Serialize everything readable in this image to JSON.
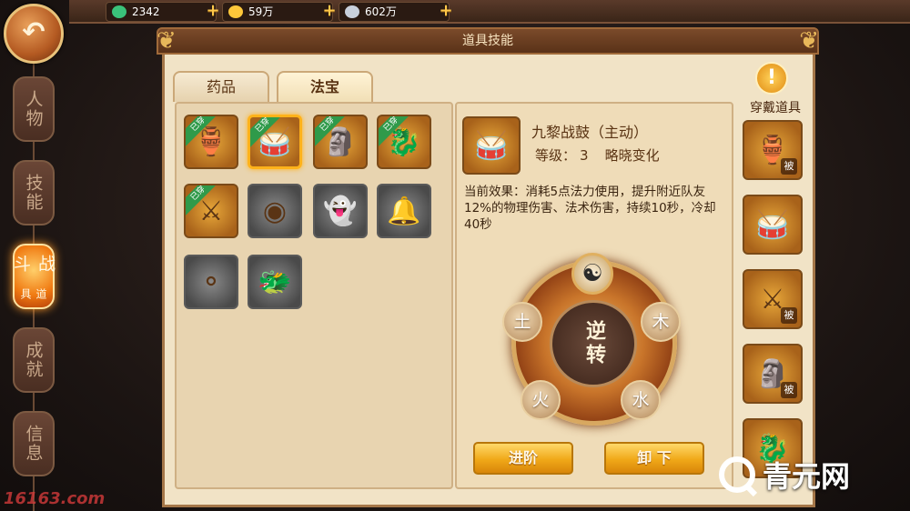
{
  "currencies": [
    {
      "value": "2342",
      "icon": "jade-icon",
      "color": "#3ac27a"
    },
    {
      "value": "59万",
      "icon": "gold-ingot-icon",
      "color": "#ffc83a"
    },
    {
      "value": "602万",
      "icon": "silver-ingot-icon",
      "color": "#c8d0dc"
    }
  ],
  "nav": {
    "items": [
      {
        "label": "人物"
      },
      {
        "label": "技能"
      },
      {
        "label": "战斗",
        "sub": "道具"
      },
      {
        "label": "成就"
      },
      {
        "label": "信息"
      }
    ],
    "active_index": 2
  },
  "panel": {
    "title": "道具技能"
  },
  "tabs": [
    {
      "label": "药品"
    },
    {
      "label": "法宝"
    }
  ],
  "inventory": {
    "equipped_tag": "已穿",
    "slots": [
      {
        "icon": "gourd-icon",
        "equipped": true,
        "colored": true
      },
      {
        "icon": "war-drum-icon",
        "equipped": true,
        "colored": true,
        "selected": true
      },
      {
        "icon": "guardian-statue-icon",
        "equipped": true,
        "colored": true
      },
      {
        "icon": "jade-guardian-icon",
        "equipped": true,
        "colored": true
      },
      {
        "icon": "crossed-swords-icon",
        "equipped": true,
        "colored": true
      },
      {
        "icon": "shield-orb-icon",
        "colored": false
      },
      {
        "icon": "ghost-icon",
        "colored": false
      },
      {
        "icon": "bell-icon",
        "colored": false
      },
      {
        "icon": "beads-icon",
        "colored": false
      },
      {
        "icon": "dragon-icon",
        "colored": false
      }
    ]
  },
  "detail": {
    "name": "九黎战鼓（主动）",
    "level_label": "等级：",
    "level_value": "3",
    "level_extra": "略晓变化",
    "effect": "当前效果：消耗5点法力使用，提升附近队友12%的物理伤害、法术伤害，持续10秒，冷却40秒",
    "wheel": {
      "center": "逆转",
      "elements": [
        "土",
        "木",
        "火",
        "水"
      ]
    },
    "buttons": {
      "advance": "进阶",
      "unequip": "卸 下"
    }
  },
  "equip_column": {
    "title": "穿戴道具",
    "pi_tag": "被",
    "slots": [
      {
        "icon": "gourd-icon",
        "passive": true
      },
      {
        "icon": "war-drum-icon",
        "passive": false
      },
      {
        "icon": "crossed-swords-icon",
        "passive": true
      },
      {
        "icon": "guardian-statue-icon",
        "passive": true
      },
      {
        "icon": "jade-guardian-icon",
        "passive": false
      }
    ]
  },
  "watermarks": {
    "left": "16163.com",
    "right": "青元网"
  }
}
